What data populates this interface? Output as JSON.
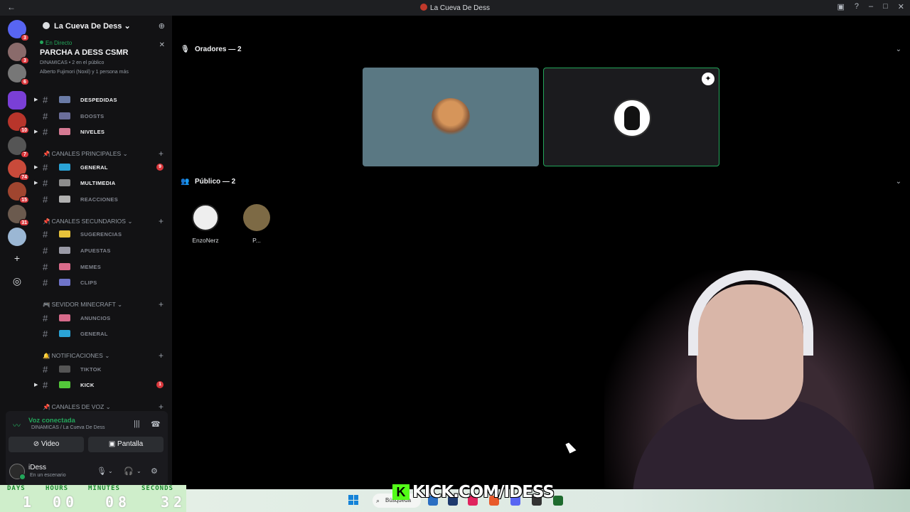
{
  "window": {
    "title": "La Cueva De Dess"
  },
  "rail": {
    "badges": [
      "3",
      "3",
      "6",
      "10",
      "7",
      "74",
      "15",
      "31"
    ]
  },
  "server": {
    "name": "La Cueva De Dess"
  },
  "stage_card": {
    "live": "En Directo",
    "title": "PARCHA A DESS CSMR",
    "meta": "DINAMICAS • 2 en el público",
    "speakers": "Alberto Fujimori (Noxil) y 1 persona más"
  },
  "channels": {
    "top": [
      {
        "name": "DESPEDIDAS",
        "unread": true
      },
      {
        "name": "BOOSTS",
        "unread": false
      },
      {
        "name": "NIVELES",
        "unread": true
      }
    ],
    "principales_label": "| CANALES PRINCIPALES",
    "principales": [
      {
        "name": "GENERAL",
        "unread": true,
        "count": "9"
      },
      {
        "name": "MULTIMEDIA",
        "unread": true
      },
      {
        "name": "REACCIONES",
        "unread": false
      }
    ],
    "secundarios_label": "| CANALES SECUNDARIOS",
    "secundarios": [
      {
        "name": "SUGERENCIAS"
      },
      {
        "name": "APUESTAS"
      },
      {
        "name": "MEMES"
      },
      {
        "name": "CLIPS"
      }
    ],
    "minecraft_label": "| SEVIDOR MINECRAFT",
    "minecraft": [
      {
        "name": "ANUNCIOS"
      },
      {
        "name": "GENERAL"
      }
    ],
    "notif_label": "| NOTIFICACIONES",
    "notif": [
      {
        "name": "TIKTOK",
        "unread": false
      },
      {
        "name": "KICK",
        "unread": true,
        "count": "1"
      }
    ],
    "voz_label": "| CANALES DE VOZ"
  },
  "voice": {
    "status": "Voz conectada",
    "channel": "DINAMICAS / La Cueva De Dess",
    "video_label": "Video",
    "screen_label": "Pantalla",
    "user_name": "iDess",
    "user_status": "En un escenario"
  },
  "stage": {
    "speakers_header": "Oradores — 2",
    "audience_header": "Público — 2",
    "audience": [
      {
        "name": "EnzoNerz"
      },
      {
        "name": "P..."
      }
    ]
  },
  "timer": {
    "labels": [
      "DAYS",
      "HOURS",
      "MINUTES",
      "SECONDS"
    ],
    "values": [
      "1",
      "00",
      "08",
      "32"
    ]
  },
  "overlay": {
    "kick_text": "KICK.COM/IDESS"
  },
  "taskbar": {
    "search_label": "Búsqueda"
  }
}
